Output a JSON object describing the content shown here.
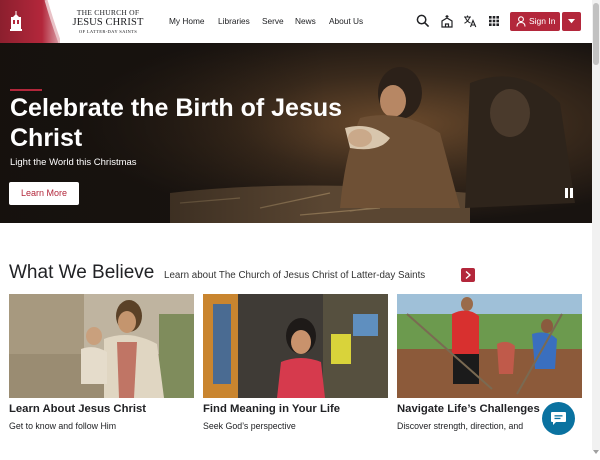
{
  "header": {
    "logo": {
      "line1": "THE CHURCH OF",
      "line2": "JESUS CHRIST",
      "line3": "OF LATTER-DAY SAINTS"
    },
    "nav": [
      "My Home",
      "Libraries",
      "Serve",
      "News",
      "About Us"
    ],
    "icons": [
      "search-icon",
      "church-icon",
      "translate-icon",
      "apps-grid-icon"
    ],
    "signin_label": "Sign In",
    "brand_color": "#b3273b"
  },
  "hero": {
    "title": "Celebrate the Birth of Jesus Christ",
    "subtitle": "Light the World this Christmas",
    "cta_label": "Learn More"
  },
  "believe": {
    "title": "What We Believe",
    "link": "Learn about The Church of Jesus Christ of Latter-day Saints",
    "cards": [
      {
        "title": "Learn About Jesus Christ",
        "subtitle": "Get to know and follow Him"
      },
      {
        "title": "Find Meaning in Your Life",
        "subtitle": "Seek God’s perspective"
      },
      {
        "title": "Navigate Life’s Challenges",
        "subtitle": "Discover strength, direction, and"
      }
    ]
  },
  "chat": {
    "icon": "chat-bubble-icon",
    "accent": "#0a72a0"
  }
}
